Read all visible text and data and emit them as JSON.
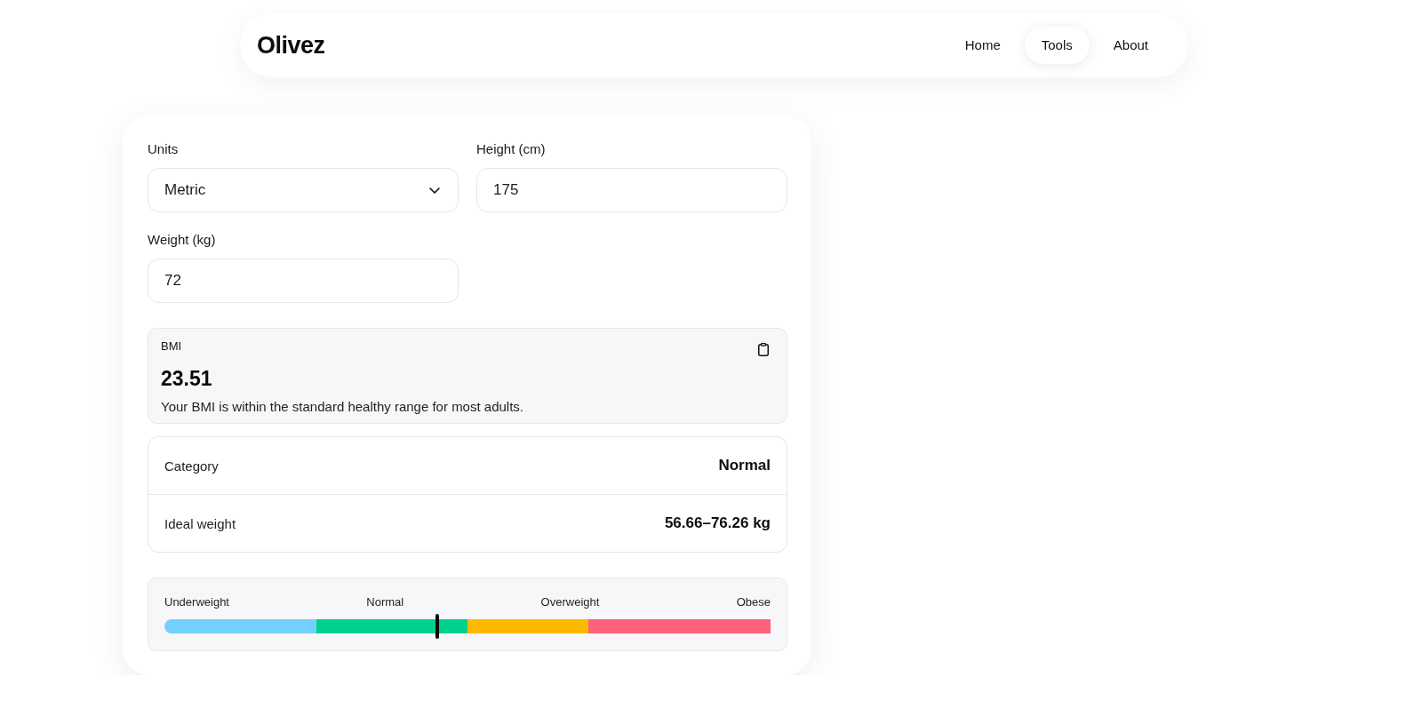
{
  "header": {
    "logo": "Olivez",
    "nav": [
      {
        "label": "Home",
        "selected": false
      },
      {
        "label": "Tools",
        "selected": true
      },
      {
        "label": "About",
        "selected": false
      }
    ]
  },
  "form": {
    "fields": [
      {
        "kind": "select",
        "label": "Units",
        "value": "Metric"
      },
      {
        "kind": "input",
        "label": "Height (cm)",
        "value": "175"
      },
      {
        "kind": "input",
        "label": "Weight (kg)",
        "value": "72"
      }
    ]
  },
  "result": {
    "label": "BMI",
    "value": "23.51",
    "description": "Your BMI is within the standard healthy range for most adults."
  },
  "details": [
    {
      "label": "Category",
      "value": "Normal"
    },
    {
      "label": "Ideal weight",
      "value": "56.66–76.26 kg"
    }
  ],
  "scale": {
    "level": 0.45,
    "categories": [
      {
        "label": "Underweight",
        "color": "#74d1fd"
      },
      {
        "label": "Normal",
        "color": "#00d08e"
      },
      {
        "label": "Overweight",
        "color": "#ffb800"
      },
      {
        "label": "Obese",
        "color": "#ff607a"
      }
    ]
  }
}
